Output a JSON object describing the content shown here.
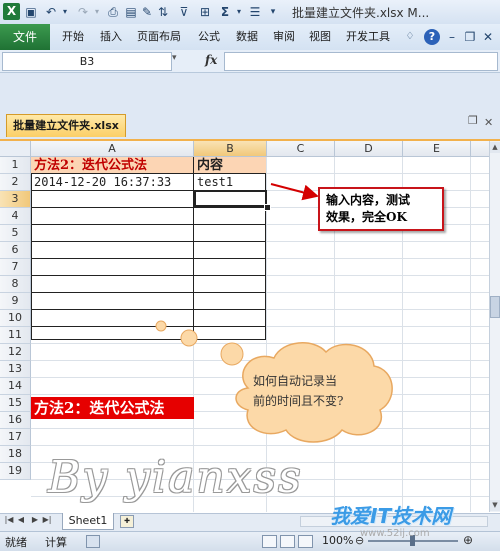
{
  "titlebar": {
    "title": "批量建立文件夹.xlsx M..."
  },
  "ribbon": {
    "file_tab": "文件",
    "tabs": [
      "开始",
      "插入",
      "页面布局",
      "公式",
      "数据",
      "审阅",
      "视图",
      "开发工具"
    ]
  },
  "formula_bar": {
    "name_box": "B3",
    "fx": "fx",
    "value": ""
  },
  "workbook": {
    "tab_name": "批量建立文件夹.xlsx"
  },
  "grid": {
    "columns": [
      "A",
      "B",
      "C",
      "D",
      "E"
    ],
    "rows": [
      "1",
      "2",
      "3",
      "4",
      "5",
      "6",
      "7",
      "8",
      "9",
      "10",
      "11",
      "12",
      "13",
      "14",
      "15",
      "16",
      "17",
      "18",
      "19"
    ],
    "selected_cell": "B3",
    "cells": {
      "A1": "方法2：迭代公式法",
      "B1": "内容",
      "A2": "2014-12-20 16:37:33",
      "B2": "test1"
    },
    "header_fill": "#fcd5b4",
    "header_text_color": "#c00000"
  },
  "annotations": {
    "callout_text_line1": "输入内容，测试",
    "callout_text_line2": "效果，完全OK",
    "cloud_text_line1": "如何自动记录当",
    "cloud_text_line2": "前的时间且不变?",
    "banner_text": "方法2：迭代公式法",
    "banner_color": "#e60000",
    "watermark": "By yianxss",
    "site_logo": "我爱IT技术网",
    "site_url": "www.52ij.com"
  },
  "sheets": {
    "tabs": [
      "Sheet1"
    ]
  },
  "statusbar": {
    "ready": "就绪",
    "calculate": "计算",
    "zoom": "100%"
  }
}
